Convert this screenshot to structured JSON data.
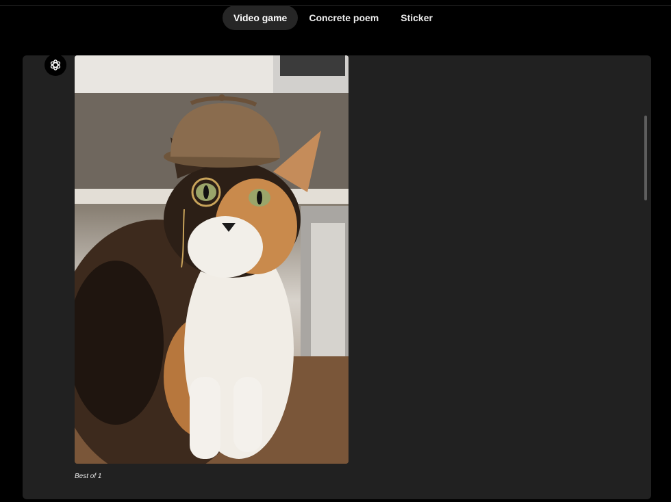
{
  "tabs": [
    {
      "label": "Video game",
      "active": true
    },
    {
      "label": "Concrete poem",
      "active": false
    },
    {
      "label": "Sticker",
      "active": false
    }
  ],
  "message": {
    "avatar_icon": "openai-logo-icon",
    "image_subject": "calico-cat-detective",
    "caption": "Best of 1"
  },
  "colors": {
    "background": "#000000",
    "panel": "#212121",
    "active_tab": "#262626",
    "scrollbar": "#5e5e5e"
  }
}
